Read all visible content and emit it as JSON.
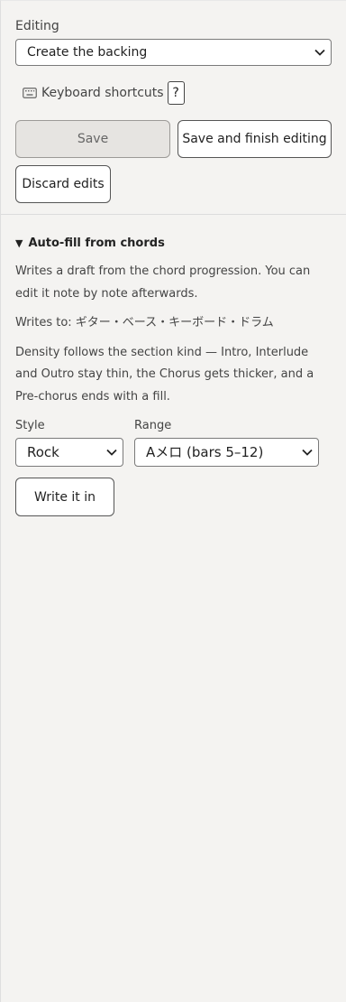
{
  "editing": {
    "label": "Editing",
    "mode_select_value": "Create the backing",
    "shortcuts_label": "Keyboard shortcuts",
    "help_button": "?",
    "save_button": "Save",
    "save_finish_button": "Save and finish editing",
    "discard_button": "Discard edits"
  },
  "autofill": {
    "summary": "Auto-fill from chords",
    "description": "Writes a draft from the chord progression. You can edit it note by note afterwards.",
    "writes_to": "Writes to: ギター・ベース・キーボード・ドラム",
    "density": "Density follows the section kind — Intro, Interlude and Outro stay thin, the Chorus gets thicker, and a Pre-chorus ends with a fill.",
    "style_label": "Style",
    "style_value": "Rock",
    "range_label": "Range",
    "range_value": "Aメロ (bars 5–12)",
    "write_button": "Write it in"
  },
  "icons": {
    "keyboard": "keyboard-icon",
    "chevron": "chevron-down-icon",
    "disclosure": "triangle-down-icon"
  },
  "colors": {
    "panel_background": "#f4f3f1",
    "disabled_button": "#e6e4e1"
  }
}
